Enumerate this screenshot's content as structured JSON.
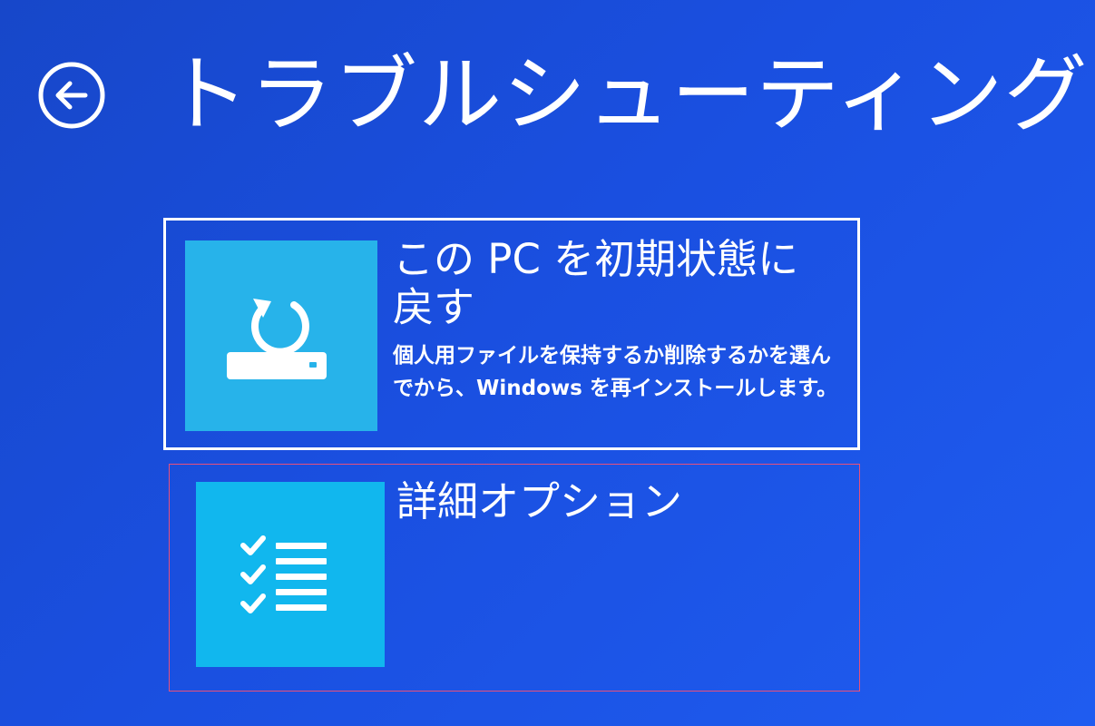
{
  "page": {
    "title": "トラブルシューティング",
    "back_icon": "back-arrow-icon"
  },
  "options": [
    {
      "title": "この PC を初期状態に戻す",
      "description": "個人用ファイルを保持するか削除するかを選んでから、Windows を再インストールします。",
      "icon": "reset-pc-icon",
      "highlighted": false
    },
    {
      "title": "詳細オプション",
      "description": "",
      "icon": "checklist-icon",
      "highlighted": true
    }
  ],
  "colors": {
    "background": "#1a4fe0",
    "tile": "#27b3ea",
    "selection_border": "#e8507a"
  }
}
